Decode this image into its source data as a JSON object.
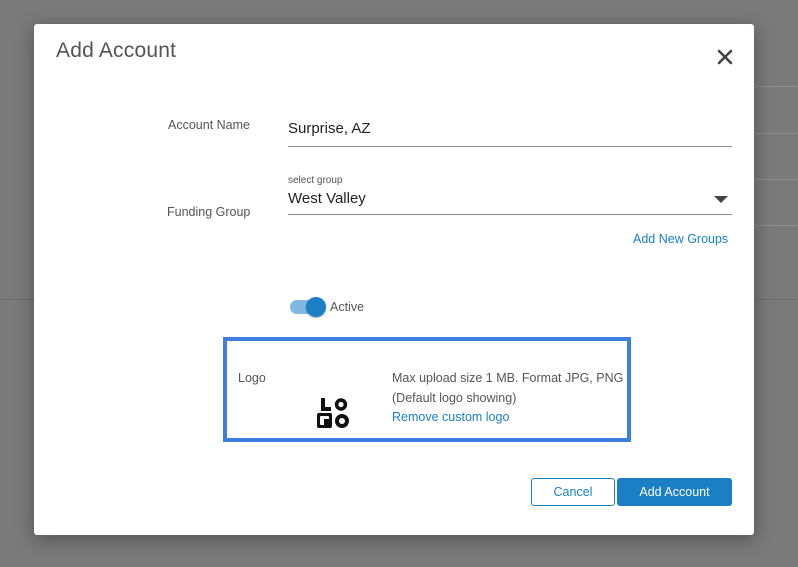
{
  "dialog": {
    "title": "Add Account"
  },
  "form": {
    "account_name": {
      "label": "Account Name",
      "value": "Surprise, AZ"
    },
    "funding_group": {
      "label": "Funding Group",
      "caption": "select group",
      "value": "West Valley"
    },
    "add_groups_link": "Add New Groups",
    "active_toggle": {
      "label": "Active",
      "on": true
    },
    "logo": {
      "label": "Logo",
      "info_line1": "Max upload size 1 MB. Format JPG, PNG",
      "info_line2": "(Default logo showing)",
      "remove_link": "Remove custom logo"
    }
  },
  "actions": {
    "cancel_label": "Cancel",
    "submit_label": "Add Account"
  },
  "colors": {
    "accent": "#1a7fc4",
    "highlight_border": "#3c7fe0"
  }
}
